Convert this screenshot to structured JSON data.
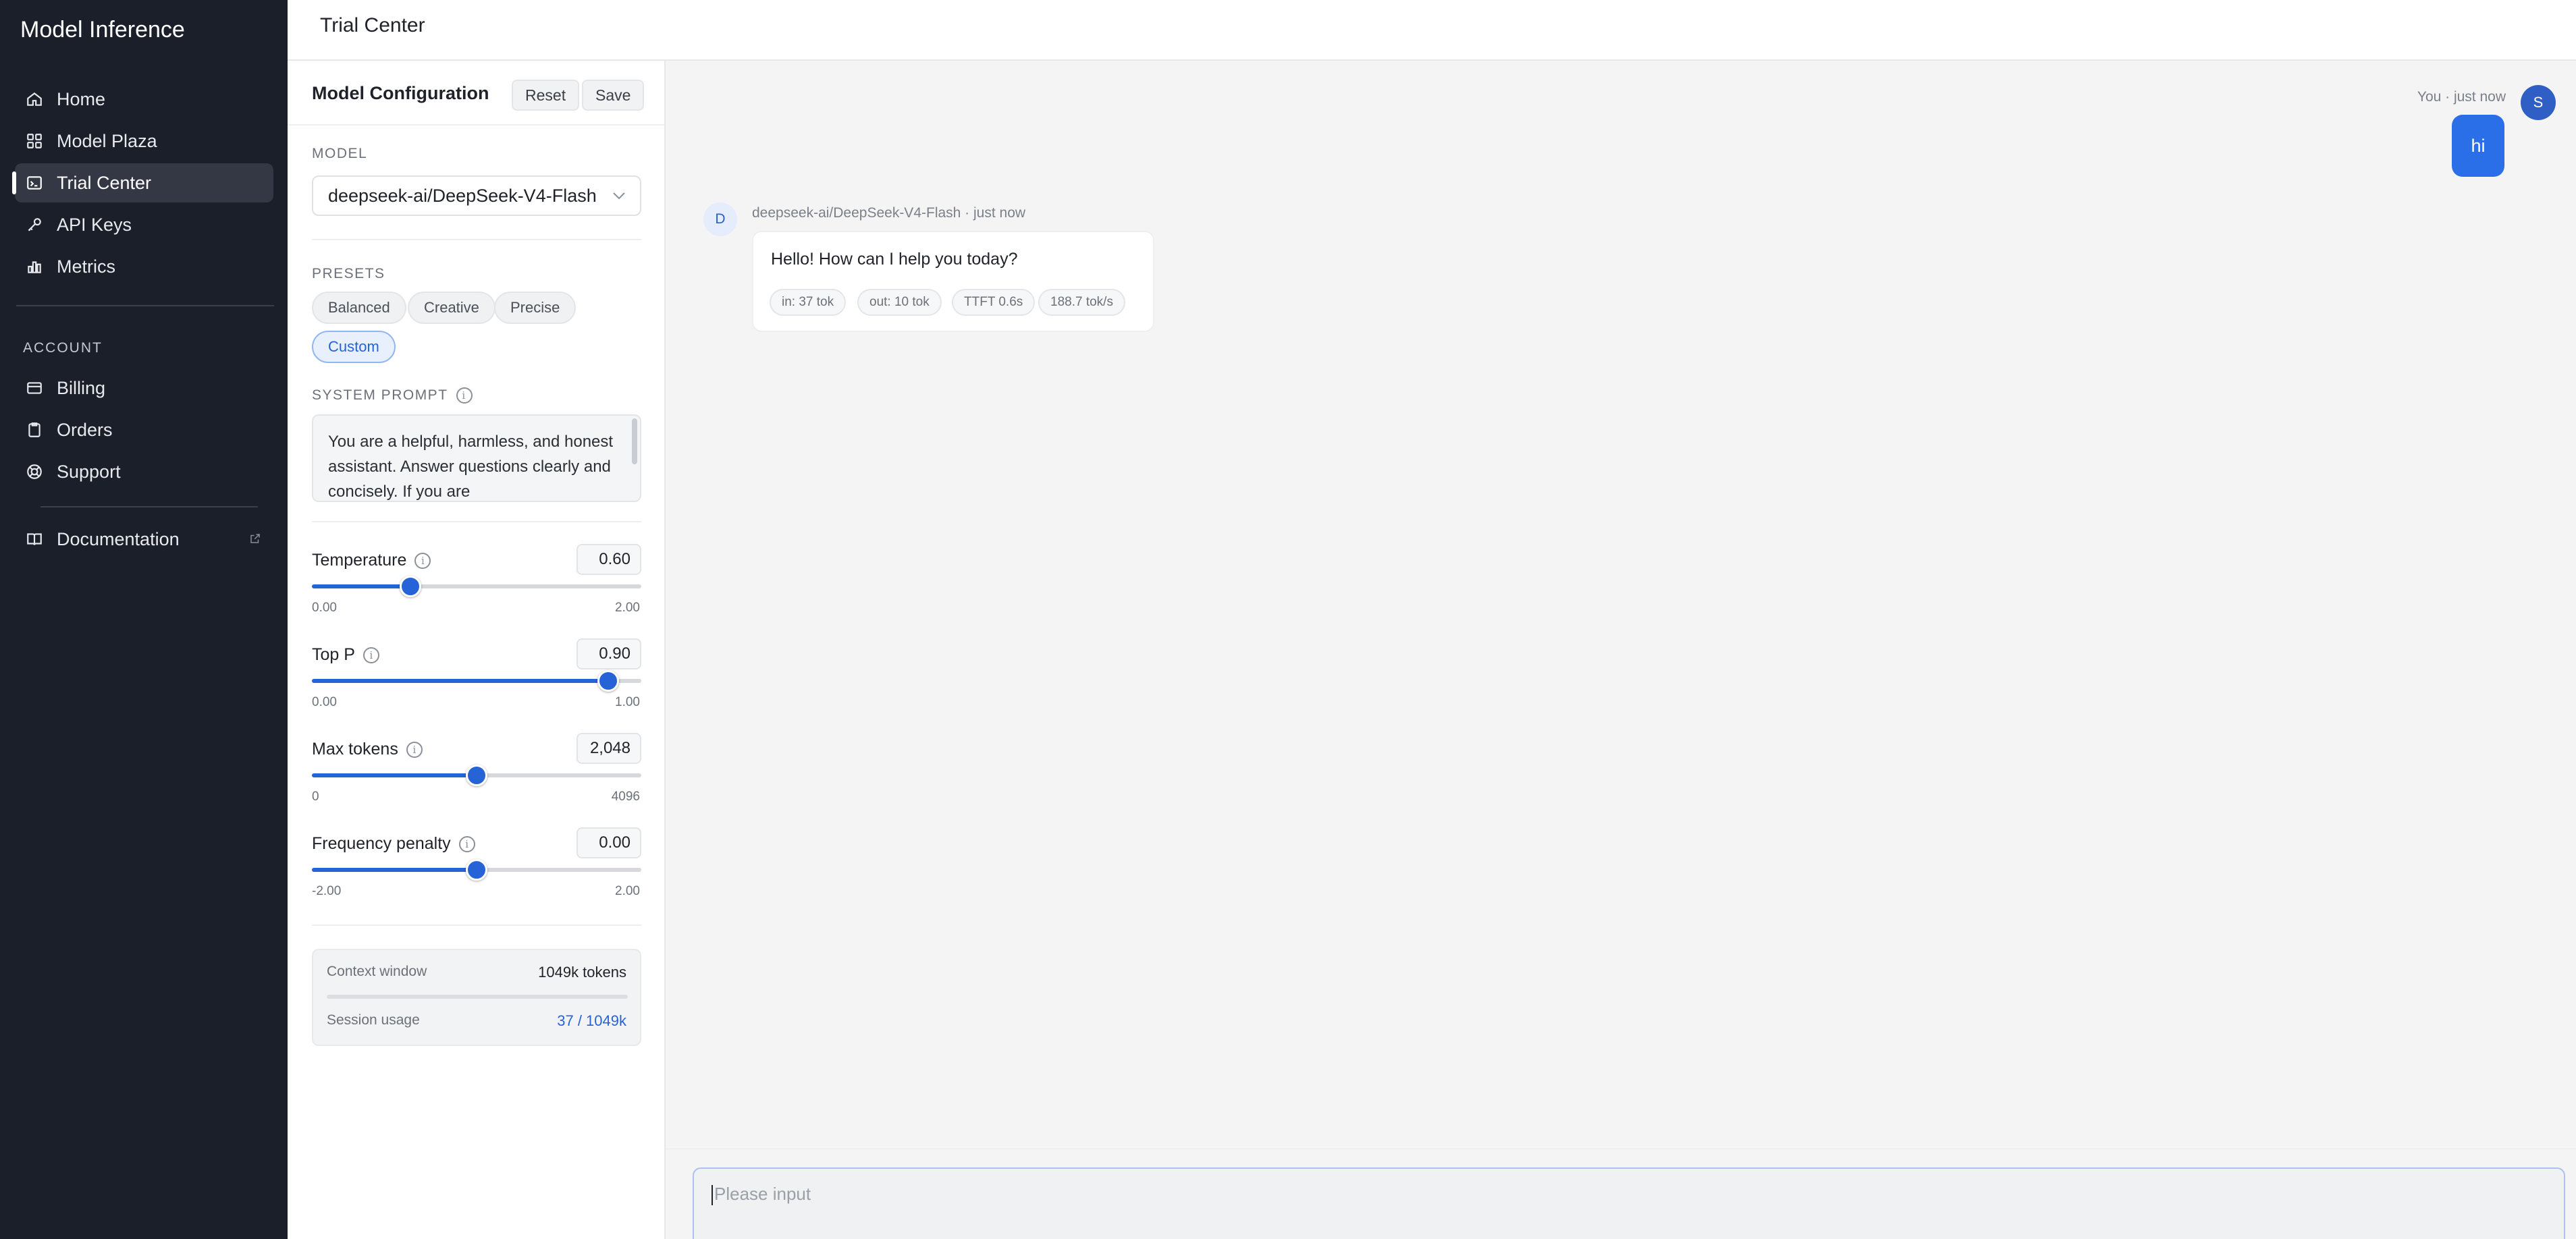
{
  "app": {
    "title": "Model Inference"
  },
  "sidebar": {
    "nav": [
      {
        "label": "Home",
        "icon": "home-icon"
      },
      {
        "label": "Model Plaza",
        "icon": "grid-icon"
      },
      {
        "label": "Trial Center",
        "icon": "terminal-icon",
        "active": true
      },
      {
        "label": "API Keys",
        "icon": "key-icon"
      },
      {
        "label": "Metrics",
        "icon": "bar-chart-icon"
      }
    ],
    "account_section": "ACCOUNT",
    "account": [
      {
        "label": "Billing",
        "icon": "credit-card-icon"
      },
      {
        "label": "Orders",
        "icon": "clipboard-icon"
      },
      {
        "label": "Support",
        "icon": "lifebuoy-icon"
      }
    ],
    "docs": {
      "label": "Documentation",
      "icon": "book-icon"
    }
  },
  "header": {
    "title": "Trial Center"
  },
  "config": {
    "title": "Model Configuration",
    "reset_label": "Reset",
    "save_label": "Save",
    "model_label": "MODEL",
    "model_value": "deepseek-ai/DeepSeek-V4-Flash",
    "presets_label": "PRESETS",
    "presets": [
      "Balanced",
      "Creative",
      "Precise",
      "Custom"
    ],
    "active_preset": "Custom",
    "system_prompt_label": "SYSTEM PROMPT",
    "system_prompt": "You are a helpful, harmless, and honest assistant. Answer questions clearly and concisely. If you are",
    "params": [
      {
        "name": "Temperature",
        "value": "0.60",
        "min": "0.00",
        "max": "2.00",
        "fraction": 0.3
      },
      {
        "name": "Top P",
        "value": "0.90",
        "min": "0.00",
        "max": "1.00",
        "fraction": 0.9
      },
      {
        "name": "Max tokens",
        "value": "2,048",
        "min": "0",
        "max": "4096",
        "fraction": 0.5
      },
      {
        "name": "Frequency penalty",
        "value": "0.00",
        "min": "-2.00",
        "max": "2.00",
        "fraction": 0.5
      }
    ],
    "context": {
      "window_label": "Context window",
      "window_value": "1049k tokens",
      "usage_label": "Session usage",
      "usage_value": "37 / 1049k"
    }
  },
  "chat": {
    "user": {
      "meta": "You · just now",
      "avatar": "S",
      "message": "hi"
    },
    "assistant": {
      "avatar": "D",
      "meta": "deepseek-ai/DeepSeek-V4-Flash · just now",
      "message": "Hello! How can I help you today?",
      "stats": [
        "in: 37 tok",
        "out: 10 tok",
        "TTFT 0.6s",
        "188.7 tok/s"
      ]
    },
    "input_placeholder": "Please input"
  },
  "colors": {
    "accent": "#2563d6",
    "sidebar_bg": "#1b1f29",
    "user_bubble": "#2b6fe8"
  }
}
